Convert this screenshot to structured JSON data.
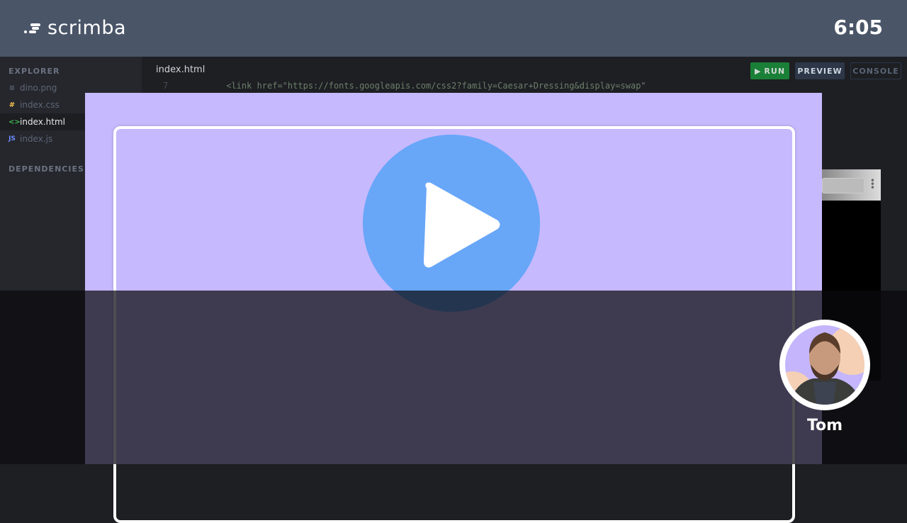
{
  "header": {
    "brand": "scrimba",
    "timer": "6:05"
  },
  "sidebar": {
    "explorer_label": "EXPLORER",
    "dependencies_label": "DEPENDENCIES",
    "files": [
      {
        "name": "dino.png",
        "icon": "lines-icon"
      },
      {
        "name": "index.css",
        "icon": "hash-icon"
      },
      {
        "name": "index.html",
        "icon": "code-icon",
        "active": true
      },
      {
        "name": "index.js",
        "icon": "js-icon"
      }
    ]
  },
  "editor": {
    "tab": "index.html",
    "run_label": "RUN",
    "preview_label": "PREVIEW",
    "console_label": "CONSOLE",
    "line_number": "7",
    "code_line": "<link href=\"https://fonts.googleapis.com/css2?family=Caesar+Dressing&display=swap\""
  },
  "player": {
    "presenter_name": "Tom"
  },
  "colors": {
    "accent_purple": "#c6b9fd",
    "play_blue": "#68a6f8",
    "run_green": "#1a7f37"
  }
}
